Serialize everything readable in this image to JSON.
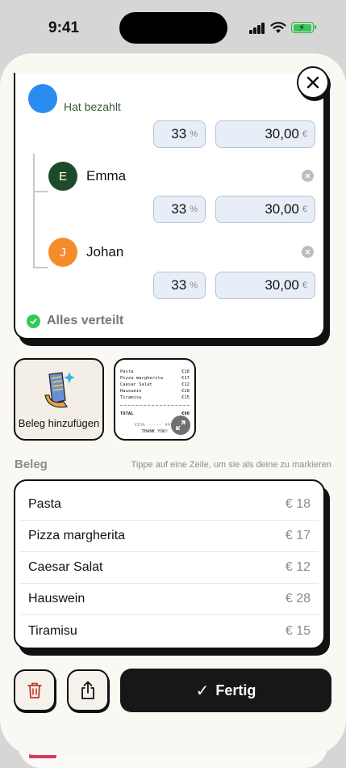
{
  "status_bar": {
    "time": "9:41"
  },
  "split": {
    "payer_status": "Hat bezahlt",
    "payer_percent": "33",
    "payer_amount": "30,00",
    "members": [
      {
        "initial": "E",
        "name": "Emma",
        "percent": "33",
        "amount": "30,00",
        "color": "#1f4a2a"
      },
      {
        "initial": "J",
        "name": "Johan",
        "percent": "33",
        "amount": "30,00",
        "color": "#f58c2a"
      }
    ],
    "percent_unit": "%",
    "currency_unit": "€",
    "all_distributed": "Alles verteilt"
  },
  "attachments": {
    "add_receipt_label": "Beleg hinzufügen",
    "receipt_preview": {
      "lines": [
        {
          "name": "Pasta",
          "price": "€18"
        },
        {
          "name": "Pizza margherita",
          "price": "€17"
        },
        {
          "name": "Caesar Salat",
          "price": "€12"
        },
        {
          "name": "Hauswein",
          "price": "€28"
        },
        {
          "name": "Tiramisu",
          "price": "€15"
        }
      ],
      "total_label": "TOTAL",
      "total_value": "€90",
      "footer_left": "VISA",
      "footer_right": "4412",
      "thanks": "THANK YOU!"
    }
  },
  "receipt": {
    "title": "Beleg",
    "hint": "Tippe auf eine Zeile, um sie als deine zu markieren",
    "items": [
      {
        "name": "Pasta",
        "price": "€ 18"
      },
      {
        "name": "Pizza margherita",
        "price": "€ 17"
      },
      {
        "name": "Caesar Salat",
        "price": "€ 12"
      },
      {
        "name": "Hauswein",
        "price": "€ 28"
      },
      {
        "name": "Tiramisu",
        "price": "€ 15"
      }
    ]
  },
  "actions": {
    "done_label": "Fertig"
  },
  "colors": {
    "accent_blue": "#2a8cf0",
    "success": "#34c759",
    "delete_red": "#c0392b",
    "dark": "#171717"
  }
}
